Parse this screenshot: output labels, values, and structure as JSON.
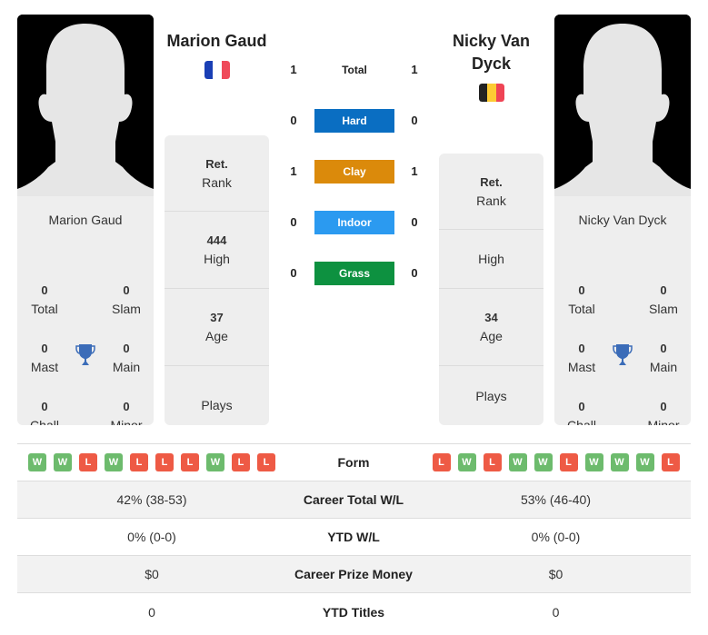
{
  "colors": {
    "hard": "#0a6ec2",
    "clay": "#db8a0b",
    "indoor": "#2b9af0",
    "grass": "#0d9140",
    "win": "#6dbb6d",
    "loss": "#ee5a45",
    "trophy": "#3b6cb8"
  },
  "player1": {
    "name": "Marion Gaud",
    "country_flag": "france-flag",
    "flag_colors": [
      "#1a3fb5",
      "#ffffff",
      "#ef4a5a"
    ],
    "card_name": "Marion Gaud",
    "titles": {
      "total": {
        "value": "0",
        "label": "Total"
      },
      "slam": {
        "value": "0",
        "label": "Slam"
      },
      "mast": {
        "value": "0",
        "label": "Mast"
      },
      "main": {
        "value": "0",
        "label": "Main"
      },
      "chall": {
        "value": "0",
        "label": "Chall"
      },
      "minor": {
        "value": "0",
        "label": "Minor"
      }
    },
    "info": {
      "rank": {
        "value": "Ret.",
        "label": "Rank"
      },
      "high": {
        "value": "444",
        "label": "High"
      },
      "age": {
        "value": "37",
        "label": "Age"
      },
      "plays": {
        "value": "",
        "label": "Plays"
      }
    },
    "form": [
      "W",
      "W",
      "L",
      "W",
      "L",
      "L",
      "L",
      "W",
      "L",
      "L"
    ]
  },
  "player2": {
    "name": "Nicky Van Dyck",
    "country_flag": "belgium-flag",
    "flag_colors": [
      "#222222",
      "#fdcb33",
      "#ef4455"
    ],
    "card_name": "Nicky Van Dyck",
    "titles": {
      "total": {
        "value": "0",
        "label": "Total"
      },
      "slam": {
        "value": "0",
        "label": "Slam"
      },
      "mast": {
        "value": "0",
        "label": "Mast"
      },
      "main": {
        "value": "0",
        "label": "Main"
      },
      "chall": {
        "value": "0",
        "label": "Chall"
      },
      "minor": {
        "value": "0",
        "label": "Minor"
      }
    },
    "info": {
      "rank": {
        "value": "Ret.",
        "label": "Rank"
      },
      "high": {
        "value": "",
        "label": "High"
      },
      "age": {
        "value": "34",
        "label": "Age"
      },
      "plays": {
        "value": "",
        "label": "Plays"
      }
    },
    "form": [
      "L",
      "W",
      "L",
      "W",
      "W",
      "L",
      "W",
      "W",
      "W",
      "L"
    ]
  },
  "h2h": [
    {
      "label": "Total",
      "p1": "1",
      "p2": "1",
      "type": "total"
    },
    {
      "label": "Hard",
      "p1": "0",
      "p2": "0",
      "type": "hard"
    },
    {
      "label": "Clay",
      "p1": "1",
      "p2": "1",
      "type": "clay"
    },
    {
      "label": "Indoor",
      "p1": "0",
      "p2": "0",
      "type": "indoor"
    },
    {
      "label": "Grass",
      "p1": "0",
      "p2": "0",
      "type": "grass"
    }
  ],
  "comparison": {
    "form_label": "Form",
    "rows": [
      {
        "label": "Career Total W/L",
        "p1": "42% (38-53)",
        "p2": "53% (46-40)"
      },
      {
        "label": "YTD W/L",
        "p1": "0% (0-0)",
        "p2": "0% (0-0)"
      },
      {
        "label": "Career Prize Money",
        "p1": "$0",
        "p2": "$0"
      },
      {
        "label": "YTD Titles",
        "p1": "0",
        "p2": "0"
      }
    ]
  }
}
